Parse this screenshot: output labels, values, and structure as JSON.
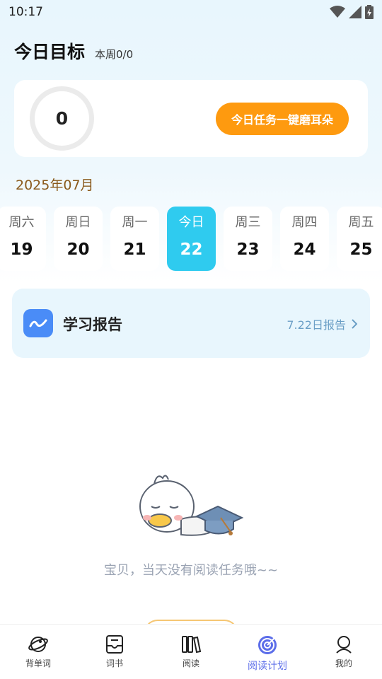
{
  "status_bar": {
    "time": "10:17"
  },
  "header": {
    "title": "今日目标",
    "week_progress": "本周0/0"
  },
  "goal": {
    "count": "0",
    "button_label": "今日任务一键磨耳朵"
  },
  "calendar": {
    "month": "2025年07月",
    "days": [
      {
        "name": "周六",
        "num": "19"
      },
      {
        "name": "周日",
        "num": "20"
      },
      {
        "name": "周一",
        "num": "21"
      },
      {
        "name": "今日",
        "num": "22"
      },
      {
        "name": "周三",
        "num": "23"
      },
      {
        "name": "周四",
        "num": "24"
      },
      {
        "name": "周五",
        "num": "25"
      }
    ],
    "active_index": 3
  },
  "report": {
    "title": "学习报告",
    "link": "7.22日报告"
  },
  "empty": {
    "message": "宝贝，当天没有阅读任务哦~~"
  },
  "tabs": [
    {
      "label": "背单词",
      "icon": "planet-icon"
    },
    {
      "label": "词书",
      "icon": "book-icon"
    },
    {
      "label": "阅读",
      "icon": "bookshelf-icon"
    },
    {
      "label": "阅读计划",
      "icon": "target-icon"
    },
    {
      "label": "我的",
      "icon": "profile-icon"
    }
  ],
  "colors": {
    "accent_orange": "#fe9a0f",
    "active_day": "#2fcbef",
    "active_tab": "#5b6de9",
    "report_bg": "#e8f6fd"
  }
}
